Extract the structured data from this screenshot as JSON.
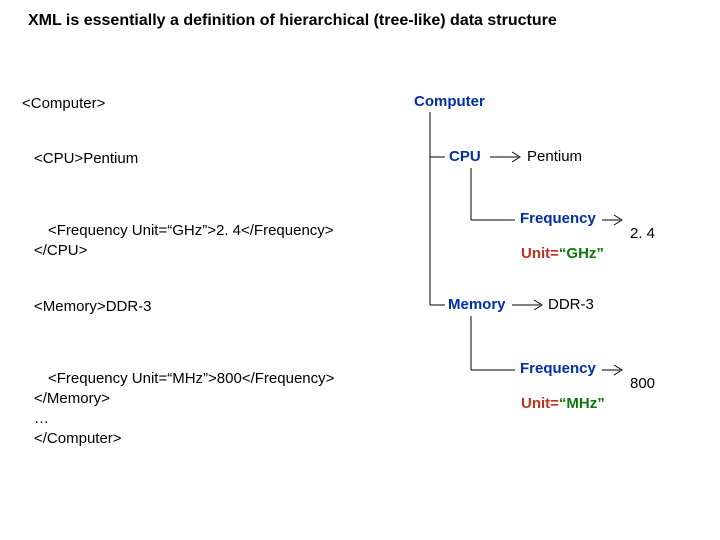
{
  "title": "XML is essentially a definition of hierarchical (tree-like) data structure",
  "xml": {
    "root_open": "<Computer>",
    "cpu_open": "<CPU>Pentium",
    "cpu_freq": "<Frequency Unit=“GHz”>2. 4</Frequency>",
    "cpu_close": "</CPU>",
    "mem_open": "<Memory>DDR-3",
    "mem_freq": "<Frequency Unit=“MHz”>800</Frequency>",
    "mem_close": "</Memory>",
    "ellipsis": "…",
    "root_close": "</Computer>"
  },
  "tree": {
    "root": "Computer",
    "cpu": {
      "name": "CPU",
      "value": "Pentium",
      "freq_label": "Frequency",
      "attr_key": "Unit=",
      "attr_val": "“GHz”",
      "freq_value": "2. 4"
    },
    "memory": {
      "name": "Memory",
      "value": "DDR-3",
      "freq_label": "Frequency",
      "attr_key": "Unit=",
      "attr_val": "“MHz”",
      "freq_value": "800"
    }
  }
}
